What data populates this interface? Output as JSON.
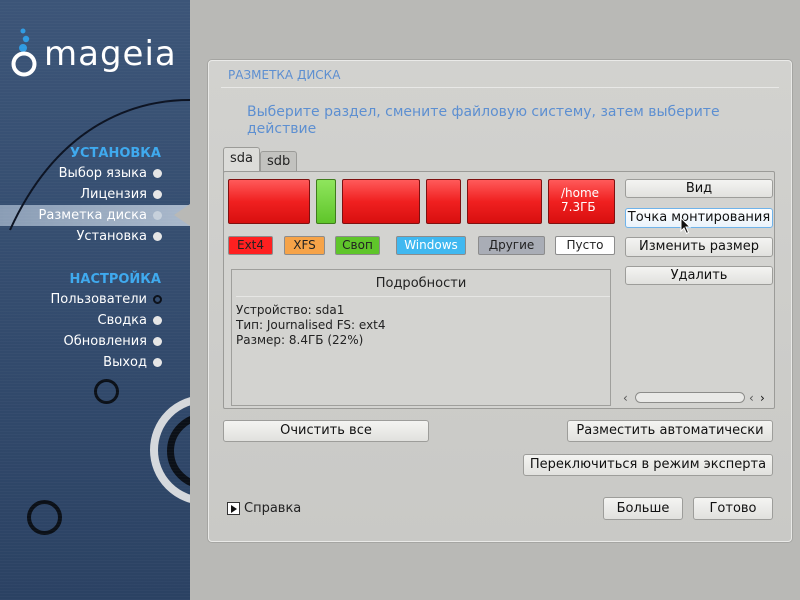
{
  "brand": {
    "logo_text": "mageia",
    "accent": "#3ea9ee"
  },
  "sidebar": {
    "sections": [
      {
        "title": "УСТАНОВКА"
      },
      {
        "title": "НАСТРОЙКА"
      }
    ],
    "items": [
      {
        "label": "Выбор языка"
      },
      {
        "label": "Лицензия"
      },
      {
        "label": "Разметка диска"
      },
      {
        "label": "Установка"
      },
      {
        "label": "Пользователи"
      },
      {
        "label": "Сводка"
      },
      {
        "label": "Обновления"
      },
      {
        "label": "Выход"
      }
    ]
  },
  "panel": {
    "title": "РАЗМЕТКА ДИСКА",
    "instruction": "Выберите раздел, смените файловую систему, затем выберите действие"
  },
  "tabs": [
    {
      "label": "sda"
    },
    {
      "label": "sdb"
    }
  ],
  "partitions": {
    "home_label": "/home",
    "home_size": "7.3ГБ"
  },
  "legend": [
    {
      "label": "Ext4",
      "color": "#ff2020",
      "text_color": "#111"
    },
    {
      "label": "XFS",
      "color": "#f6a348",
      "text_color": "#111"
    },
    {
      "label": "Своп",
      "color": "#5fc52a",
      "text_color": "#111"
    },
    {
      "label": "Windows",
      "color": "#40b8f0",
      "text_color": "#fff"
    },
    {
      "label": "Другие",
      "color": "#a9adb6",
      "text_color": "#111"
    },
    {
      "label": "Пусто",
      "color": "#ffffff",
      "text_color": "#111"
    }
  ],
  "details": {
    "header": "Подробности",
    "device": "Устройство: sda1",
    "type": "Тип: Journalised FS: ext4",
    "size": "Размер: 8.4ГБ (22%)"
  },
  "actions": {
    "view": "Вид",
    "mount_point": "Точка монтирования",
    "resize": "Изменить размер",
    "delete": "Удалить"
  },
  "footer": {
    "clear_all": "Очистить все",
    "auto_allocate": "Разместить автоматически",
    "expert_mode": "Переключиться в режим эксперта",
    "help": "Справка",
    "more": "Больше",
    "done": "Готово"
  }
}
